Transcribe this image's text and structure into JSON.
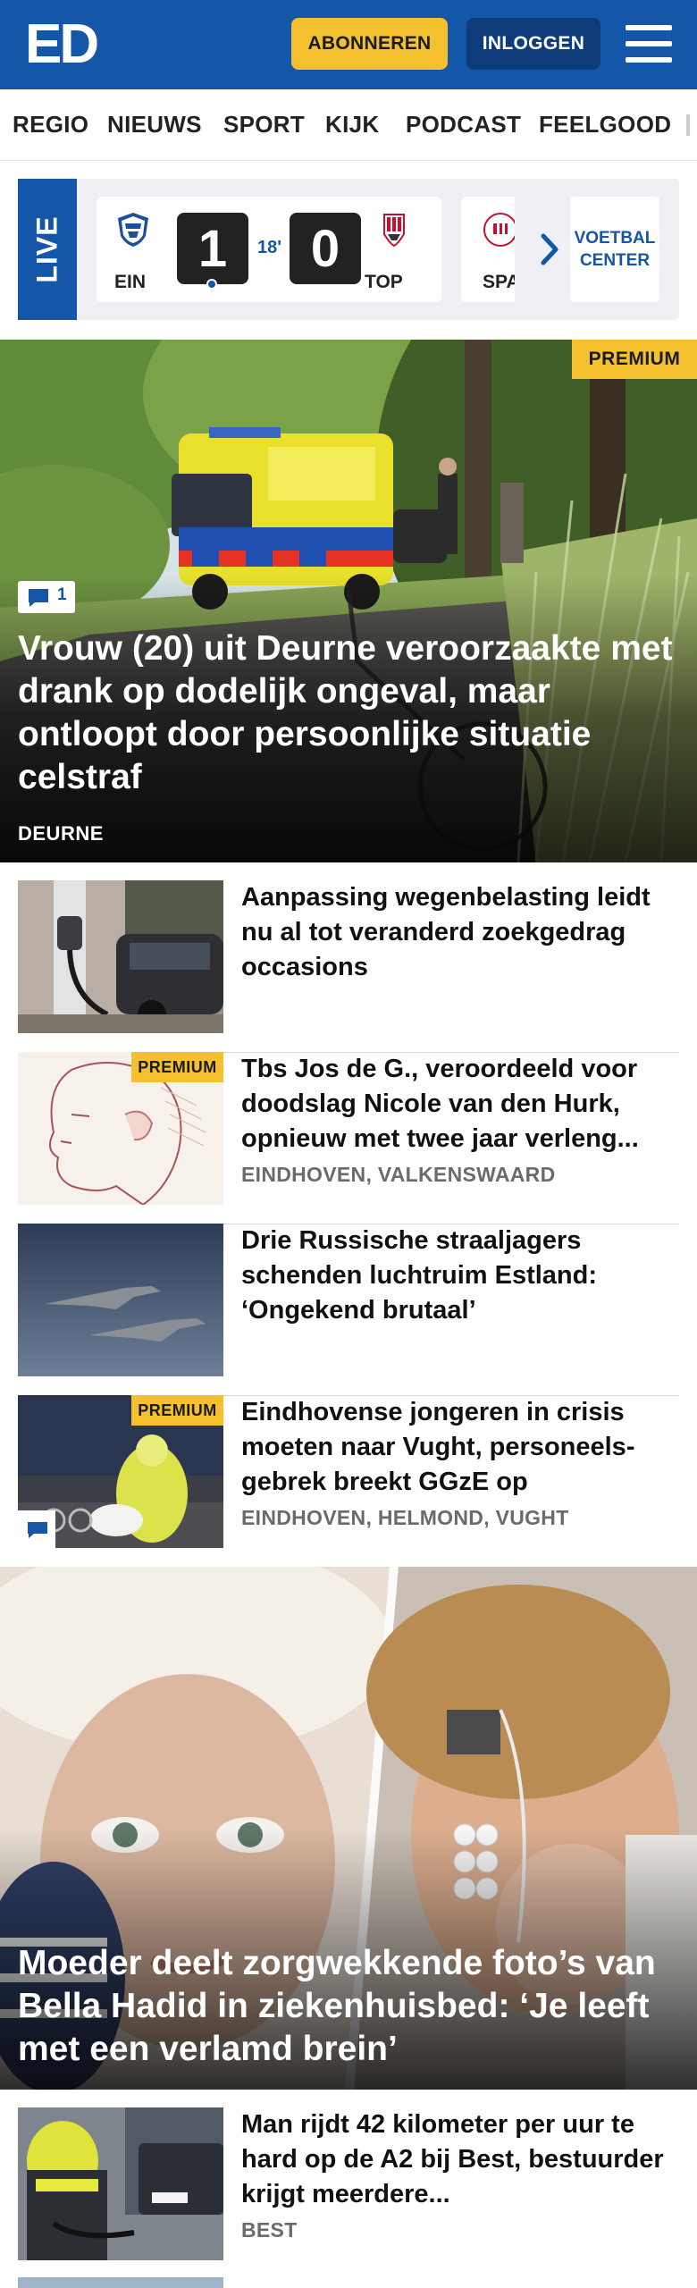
{
  "header": {
    "logo": "ED",
    "subscribe_label": "ABONNEREN",
    "login_label": "INLOGGEN",
    "menu_icon": "hamburger-menu-icon",
    "brand_color": "#1456a8",
    "accent_color": "#f4c02e"
  },
  "nav": {
    "items": [
      "REGIO",
      "NIEUWS",
      "SPORT",
      "KIJK",
      "PODCAST",
      "FEELGOOD"
    ]
  },
  "live": {
    "label": "LIVE",
    "match": {
      "home_team": "EIN",
      "away_team": "TOP",
      "home_score": "1",
      "away_score": "0",
      "minute": "18'"
    },
    "next_team": "SPA",
    "voetbal_center_line1": "VOETBAL",
    "voetbal_center_line2": "CENTER"
  },
  "hero": {
    "badge": "PREMIUM",
    "comments": "1",
    "title": "Vrouw (20) uit Deurne veroorzaakte met drank op dodelijk ongeval, maar ontloopt door persoonlijke situatie celstraf",
    "location": "DEURNE"
  },
  "articles": [
    {
      "title": "Aanpassing wegenbelasting leidt nu al tot veranderd zoekgedrag occasions",
      "location": "",
      "premium": false
    },
    {
      "title": "Tbs Jos de G., veroordeeld voor doodslag Nicole van den Hurk, opnieuw met twee jaar verleng...",
      "location": "EINDHOVEN, VALKENSWAARD",
      "premium": true,
      "badge": "PREMIUM"
    },
    {
      "title": "Drie Russische straaljagers schenden luchtruim Estland: ‘Ongekend brutaal’",
      "location": "",
      "premium": false
    },
    {
      "title": "Eindhovense jongeren in crisis moeten naar Vught, personeels­gebrek breekt GGzE op",
      "location": "EINDHOVEN, HELMOND, VUGHT",
      "premium": true,
      "badge": "PREMIUM"
    }
  ],
  "feature": {
    "title": "Moeder deelt zorgwekkende foto’s van Bella Hadid in ziekenhuisbed: ‘Je leeft met een verlamd brein’"
  },
  "last_article": {
    "title": "Man rijdt 42 kilometer per uur te hard op de A2 bij Best, bestuurder krijgt meerdere...",
    "location": "BEST"
  }
}
